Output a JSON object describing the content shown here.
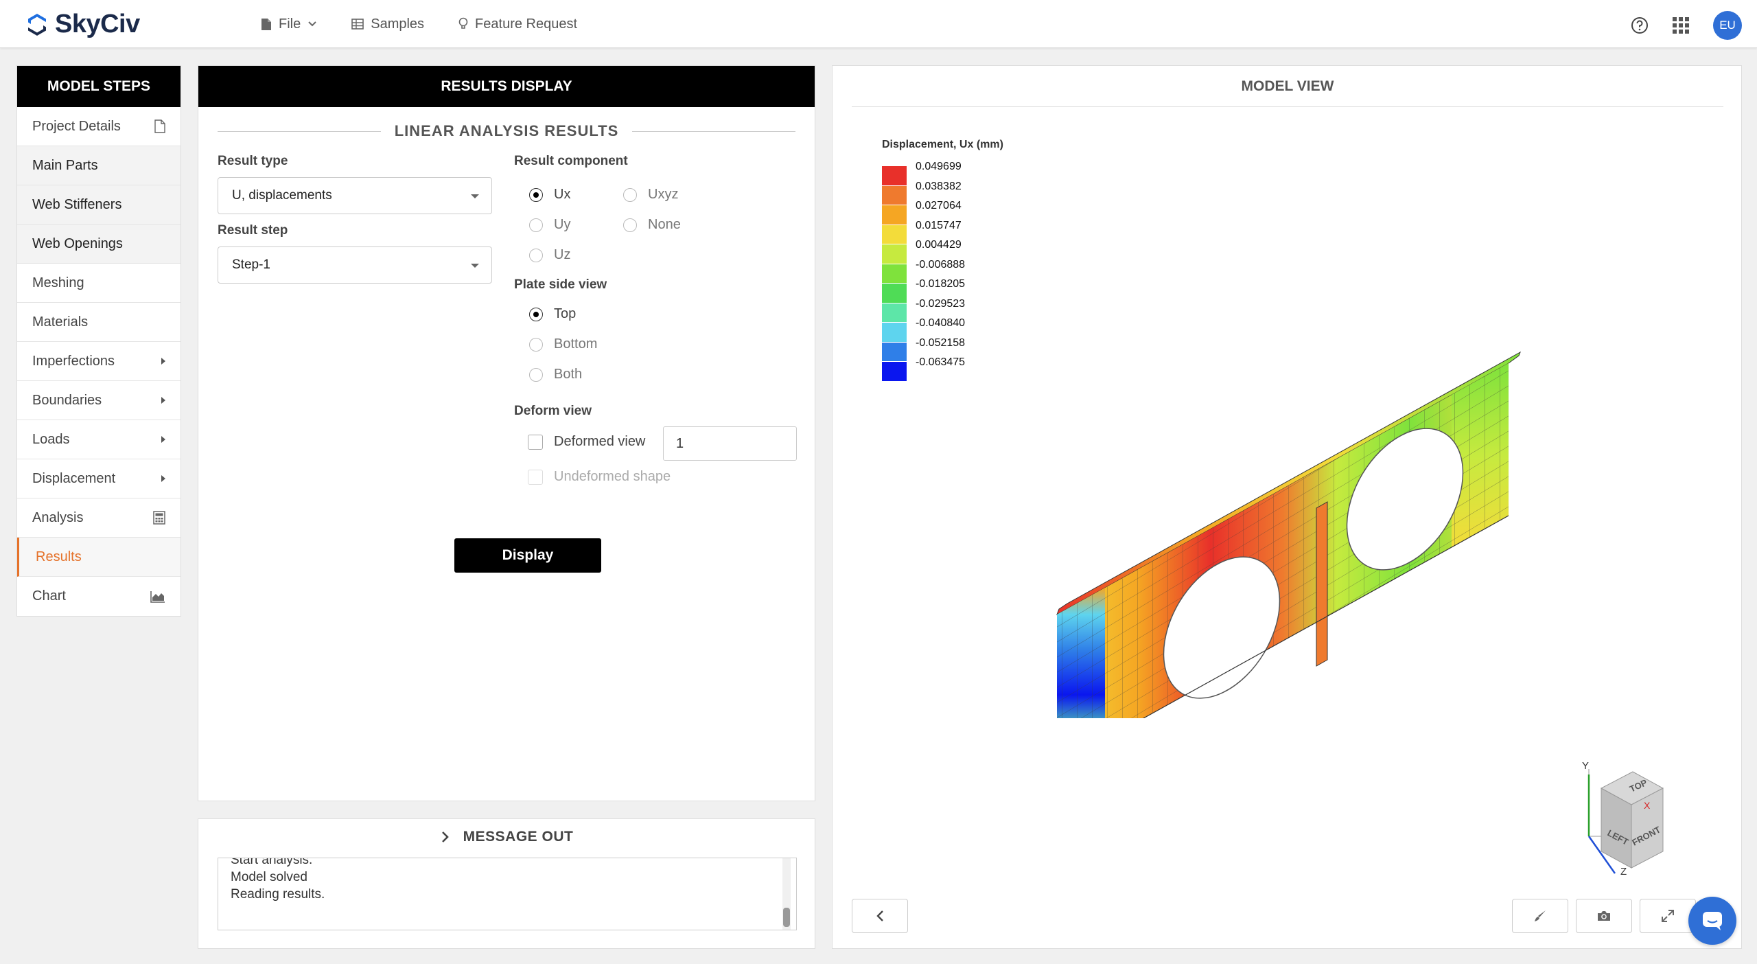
{
  "app": {
    "name": "SkyCiv"
  },
  "topnav": {
    "file": "File",
    "samples": "Samples",
    "feature_request": "Feature Request"
  },
  "user": {
    "initials": "EU"
  },
  "sidebar": {
    "title": "MODEL STEPS",
    "items": [
      {
        "label": "Project Details",
        "icon": "document-icon"
      },
      {
        "label": "Main Parts"
      },
      {
        "label": "Web Stiffeners"
      },
      {
        "label": "Web Openings"
      },
      {
        "label": "Meshing"
      },
      {
        "label": "Materials"
      },
      {
        "label": "Imperfections",
        "icon": "caret-right-icon"
      },
      {
        "label": "Boundaries",
        "icon": "caret-right-icon"
      },
      {
        "label": "Loads",
        "icon": "caret-right-icon"
      },
      {
        "label": "Displacement",
        "icon": "caret-right-icon"
      },
      {
        "label": "Analysis",
        "icon": "calculator-icon"
      },
      {
        "label": "Results"
      },
      {
        "label": "Chart",
        "icon": "area-chart-icon"
      }
    ]
  },
  "results": {
    "title": "RESULTS DISPLAY",
    "section": "LINEAR ANALYSIS RESULTS",
    "result_type_label": "Result type",
    "result_type_value": "U, displacements",
    "result_step_label": "Result step",
    "result_step_value": "Step-1",
    "component_label": "Result component",
    "components": [
      "Ux",
      "Uxyz",
      "Uy",
      "None",
      "Uz"
    ],
    "plate_side_label": "Plate side view",
    "plate_sides": [
      "Top",
      "Bottom",
      "Both"
    ],
    "deform_label": "Deform view",
    "deformed_view_label": "Deformed view",
    "deformed_scale": "1",
    "undeformed_label": "Undeformed shape",
    "display_button": "Display"
  },
  "message": {
    "title": "MESSAGE OUT",
    "lines": [
      "Start analysis.",
      "Model solved",
      "Reading results."
    ]
  },
  "model_view": {
    "title": "MODEL VIEW",
    "legend_title": "Displacement, Ux (mm)",
    "legend_values": [
      "0.049699",
      "0.038382",
      "0.027064",
      "0.015747",
      "0.004429",
      "-0.006888",
      "-0.018205",
      "-0.029523",
      "-0.040840",
      "-0.052158",
      "-0.063475"
    ],
    "legend_colors": [
      "#e8302a",
      "#ef7a2e",
      "#f5a623",
      "#f3dc3a",
      "#c6ea3f",
      "#7fe23c",
      "#4fdc56",
      "#5de6a8",
      "#5ed4ee",
      "#2f7fe8",
      "#0a16ef"
    ],
    "cube_labels": {
      "top": "TOP",
      "left": "LEFT",
      "front": "FRONT"
    },
    "axes": {
      "x": "X",
      "y": "Y",
      "z": "Z"
    }
  }
}
